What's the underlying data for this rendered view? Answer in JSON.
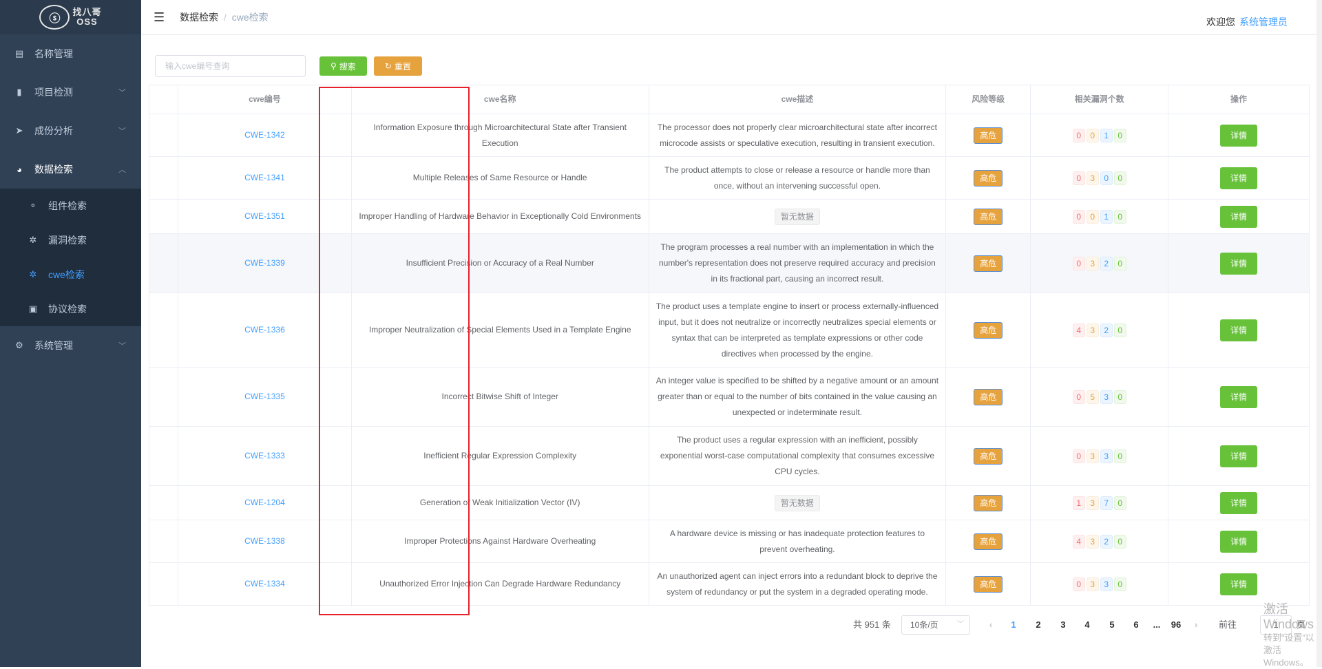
{
  "logo": {
    "badge": "ⓢ",
    "line1": "找八哥",
    "line2": "OSS"
  },
  "sidebar": {
    "items": [
      {
        "label": "名称管理",
        "icon": "document-edit-icon"
      },
      {
        "label": "项目检测",
        "icon": "bar-chart-icon"
      },
      {
        "label": "成份分析",
        "icon": "paper-plane-icon"
      },
      {
        "label": "数据检索",
        "icon": "dashboard-icon"
      },
      {
        "label": "组件检索",
        "icon": "component-icon"
      },
      {
        "label": "漏洞检索",
        "icon": "bug-icon"
      },
      {
        "label": "cwe检索",
        "icon": "bug-icon"
      },
      {
        "label": "协议检索",
        "icon": "protocol-icon"
      },
      {
        "label": "系统管理",
        "icon": "gear-icon"
      }
    ]
  },
  "header": {
    "breadcrumb_1": "数据检索",
    "breadcrumb_sep": "/",
    "breadcrumb_2": "cwe检索",
    "welcome": "欢迎您",
    "user": "系统管理员"
  },
  "filter": {
    "placeholder": "输入cwe编号查询",
    "search_label": "搜索",
    "reset_label": "重置"
  },
  "table": {
    "columns": [
      "cwe编号",
      "cwe名称",
      "cwe描述",
      "风险等级",
      "相关漏洞个数",
      "操作"
    ],
    "rows": [
      {
        "id": "CWE-1342",
        "name": "Information Exposure through Microarchitectural State after Transient Execution",
        "desc": "The processor does not properly clear microarchitectural state after incorrect microcode assists or speculative execution, resulting in transient execution.",
        "risk": "高危",
        "counts": [
          "0",
          "0",
          "1",
          "0"
        ],
        "action": "详情"
      },
      {
        "id": "CWE-1341",
        "name": "Multiple Releases of Same Resource or Handle",
        "desc": "The product attempts to close or release a resource or handle more than once, without an intervening successful open.",
        "risk": "高危",
        "counts": [
          "0",
          "3",
          "0",
          "0"
        ],
        "action": "详情"
      },
      {
        "id": "CWE-1351",
        "name": "Improper Handling of Hardware Behavior in Exceptionally Cold Environments",
        "desc": "暂无数据",
        "risk": "高危",
        "counts": [
          "0",
          "0",
          "1",
          "0"
        ],
        "action": "详情"
      },
      {
        "id": "CWE-1339",
        "name": "Insufficient Precision or Accuracy of a Real Number",
        "desc": "The program processes a real number with an implementation in which the number's representation does not preserve required accuracy and precision in its fractional part, causing an incorrect result.",
        "risk": "高危",
        "counts": [
          "0",
          "3",
          "2",
          "0"
        ],
        "action": "详情"
      },
      {
        "id": "CWE-1336",
        "name": "Improper Neutralization of Special Elements Used in a Template Engine",
        "desc": "The product uses a template engine to insert or process externally-influenced input, but it does not neutralize or incorrectly neutralizes special elements or syntax that can be interpreted as template expressions or other code directives when processed by the engine.",
        "risk": "高危",
        "counts": [
          "4",
          "3",
          "2",
          "0"
        ],
        "action": "详情"
      },
      {
        "id": "CWE-1335",
        "name": "Incorrect Bitwise Shift of Integer",
        "desc": "An integer value is specified to be shifted by a negative amount or an amount greater than or equal to the number of bits contained in the value causing an unexpected or indeterminate result.",
        "risk": "高危",
        "counts": [
          "0",
          "5",
          "3",
          "0"
        ],
        "action": "详情"
      },
      {
        "id": "CWE-1333",
        "name": "Inefficient Regular Expression Complexity",
        "desc": "The product uses a regular expression with an inefficient, possibly exponential worst-case computational complexity that consumes excessive CPU cycles.",
        "risk": "高危",
        "counts": [
          "0",
          "3",
          "3",
          "0"
        ],
        "action": "详情"
      },
      {
        "id": "CWE-1204",
        "name": "Generation of Weak Initialization Vector (IV)",
        "desc": "暂无数据",
        "risk": "高危",
        "counts": [
          "1",
          "3",
          "7",
          "0"
        ],
        "action": "详情"
      },
      {
        "id": "CWE-1338",
        "name": "Improper Protections Against Hardware Overheating",
        "desc": "A hardware device is missing or has inadequate protection features to prevent overheating.",
        "risk": "高危",
        "counts": [
          "4",
          "3",
          "2",
          "0"
        ],
        "action": "详情"
      },
      {
        "id": "CWE-1334",
        "name": "Unauthorized Error Injection Can Degrade Hardware Redundancy",
        "desc": "An unauthorized agent can inject errors into a redundant block to deprive the system of redundancy or put the system in a degraded operating mode.",
        "risk": "高危",
        "counts": [
          "0",
          "3",
          "3",
          "0"
        ],
        "action": "详情"
      }
    ]
  },
  "pagination": {
    "total": "共 951 条",
    "page_size": "10条/页",
    "prev": "‹",
    "pages": [
      "1",
      "2",
      "3",
      "4",
      "5",
      "6",
      "...",
      "96"
    ],
    "next": "›",
    "goto_label": "前往",
    "goto_value": "1",
    "goto_unit": "页"
  },
  "watermark": {
    "line1": "激活 Windows",
    "line2": "转到“设置”以激活 Windows。"
  },
  "colors": {
    "sidebar_bg": "#304156",
    "accent": "#409eff",
    "success": "#67c23a",
    "warning": "#e6a23c",
    "highlight_box": "#e8202a"
  }
}
